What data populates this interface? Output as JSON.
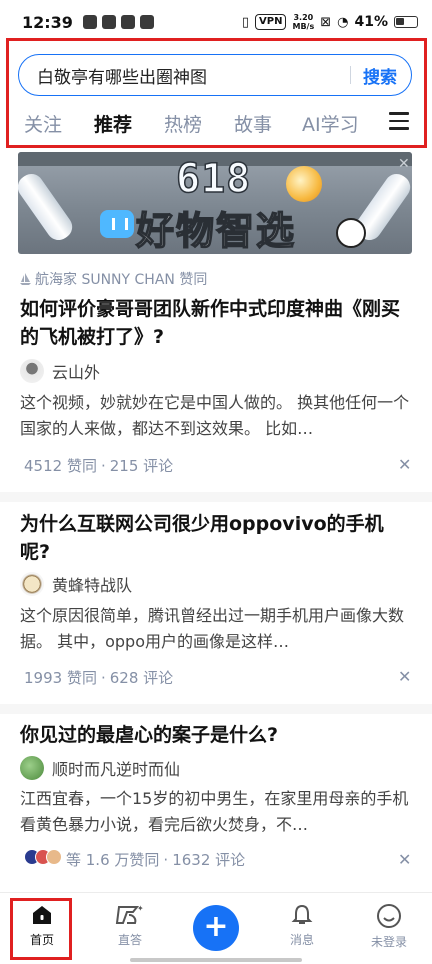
{
  "status_bar": {
    "time": "12:39",
    "vpn": "VPN",
    "net_speed": "3.20\nMB/s",
    "battery": "41%"
  },
  "search": {
    "query": "白敬亭有哪些出圈神图",
    "button": "搜索"
  },
  "tabs": [
    {
      "label": "关注",
      "active": false
    },
    {
      "label": "推荐",
      "active": true
    },
    {
      "label": "热榜",
      "active": false
    },
    {
      "label": "故事",
      "active": false
    },
    {
      "label": "AI学习",
      "active": false
    }
  ],
  "banner": {
    "number": "618",
    "slogan": "好物智选"
  },
  "feed": [
    {
      "source": "航海家 SUNNY CHAN 赞同",
      "title": "如何评价豪哥哥团队新作中式印度神曲《刚买的飞机被打了》?",
      "author": "云山外",
      "excerpt": "这个视频，妙就妙在它是中国人做的。 换其他任何一个国家的人来做，都达不到这效果。 比如…",
      "likes": "4512 赞同",
      "comments": "215 评论"
    },
    {
      "source": "",
      "title": "为什么互联网公司很少用oppovivo的手机呢?",
      "author": "黄蜂特战队",
      "excerpt": "这个原因很简单，腾讯曾经出过一期手机用户画像大数据。  其中，oppo用户的画像是这样…",
      "likes": "1993 赞同",
      "comments": "628 评论"
    },
    {
      "source": "",
      "title": "你见过的最虐心的案子是什么?",
      "author": "顺时而凡逆时而仙",
      "excerpt": "江西宜春，一个15岁的初中男生，在家里用母亲的手机看黄色暴力小说，看完后欲火焚身，不…",
      "likes": "等 1.6 万赞同",
      "comments": "1632 评论"
    }
  ],
  "bottom_nav": {
    "home": "首页",
    "answer": "直答",
    "messages": "消息",
    "login": "未登录"
  },
  "colors": {
    "accent": "#1772f6",
    "highlight": "#e02020",
    "muted": "#8590a6"
  }
}
